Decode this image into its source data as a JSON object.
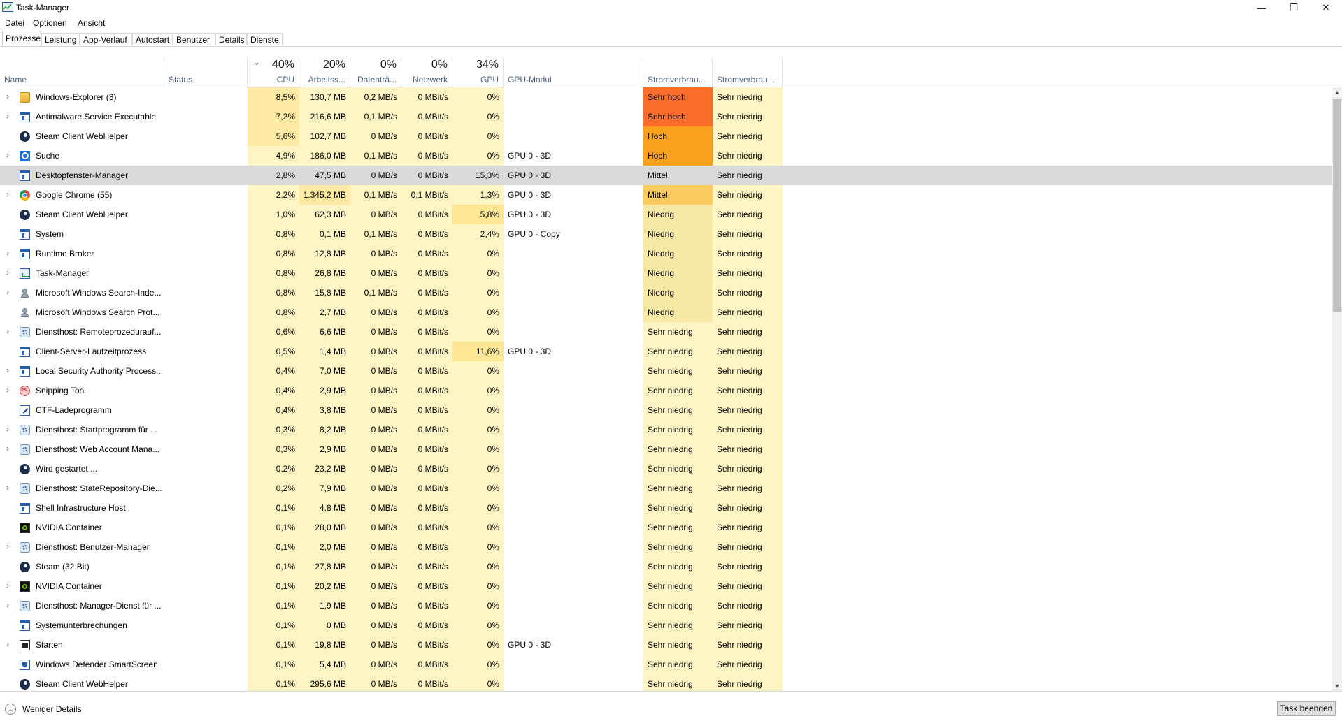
{
  "window": {
    "title": "Task-Manager",
    "minimize_glyph": "—",
    "maximize_glyph": "❐",
    "close_glyph": "✕"
  },
  "menu": [
    "Datei",
    "Optionen",
    "Ansicht"
  ],
  "tabs": [
    "Prozesse",
    "Leistung",
    "App-Verlauf",
    "Autostart",
    "Benutzer",
    "Details",
    "Dienste"
  ],
  "active_tab": "Prozesse",
  "columns": {
    "name": "Name",
    "status": "Status",
    "cpu": {
      "pct": "40%",
      "label": "CPU"
    },
    "mem": {
      "pct": "20%",
      "label": "Arbeitss..."
    },
    "disk": {
      "pct": "0%",
      "label": "Datenträ..."
    },
    "net": {
      "pct": "0%",
      "label": "Netzwerk"
    },
    "gpu": {
      "pct": "34%",
      "label": "GPU"
    },
    "gpumod": "GPU-Modul",
    "power": "Stromverbrau...",
    "power2": "Stromverbrau...",
    "sort_glyph": "⌄"
  },
  "heat_colors": {
    "light": "#fff4c4",
    "medium": "#ffeaa4",
    "gpu_high": "#fde694",
    "sehr_hoch": "#fb6d2a",
    "hoch": "#f8a11f",
    "mittel": "#fbcb61",
    "niedrig": "#f8e8a6",
    "sehr_niedrig": "#fff4c4"
  },
  "processes": [
    {
      "expandable": true,
      "icon": "folder",
      "name": "Windows-Explorer (3)",
      "cpu": "8,5%",
      "mem": "130,7 MB",
      "disk": "0,2 MB/s",
      "net": "0 MBit/s",
      "gpu": "0%",
      "gpumod": "",
      "power": "Sehr hoch",
      "power2": "Sehr niedrig"
    },
    {
      "expandable": true,
      "icon": "window",
      "name": "Antimalware Service Executable",
      "cpu": "7,2%",
      "mem": "216,6 MB",
      "disk": "0,1 MB/s",
      "net": "0 MBit/s",
      "gpu": "0%",
      "gpumod": "",
      "power": "Sehr hoch",
      "power2": "Sehr niedrig"
    },
    {
      "expandable": false,
      "icon": "steam",
      "name": "Steam Client WebHelper",
      "cpu": "5,6%",
      "mem": "102,7 MB",
      "disk": "0 MB/s",
      "net": "0 MBit/s",
      "gpu": "0%",
      "gpumod": "",
      "power": "Hoch",
      "power2": "Sehr niedrig"
    },
    {
      "expandable": true,
      "icon": "search",
      "name": "Suche",
      "cpu": "4,9%",
      "mem": "186,0 MB",
      "disk": "0,1 MB/s",
      "net": "0 MBit/s",
      "gpu": "0%",
      "gpumod": "GPU 0 - 3D",
      "power": "Hoch",
      "power2": "Sehr niedrig"
    },
    {
      "expandable": false,
      "icon": "window",
      "name": "Desktopfenster-Manager",
      "cpu": "2,8%",
      "mem": "47,5 MB",
      "disk": "0 MB/s",
      "net": "0 MBit/s",
      "gpu": "15,3%",
      "gpumod": "GPU 0 - 3D",
      "power": "Mittel",
      "power2": "Sehr niedrig",
      "selected": true
    },
    {
      "expandable": true,
      "icon": "chrome",
      "name": "Google Chrome (55)",
      "cpu": "2,2%",
      "mem": "1.345,2 MB",
      "disk": "0,1 MB/s",
      "net": "0,1 MBit/s",
      "gpu": "1,3%",
      "gpumod": "GPU 0 - 3D",
      "power": "Mittel",
      "power2": "Sehr niedrig"
    },
    {
      "expandable": false,
      "icon": "steam",
      "name": "Steam Client WebHelper",
      "cpu": "1,0%",
      "mem": "62,3 MB",
      "disk": "0 MB/s",
      "net": "0 MBit/s",
      "gpu": "5,8%",
      "gpumod": "GPU 0 - 3D",
      "power": "Niedrig",
      "power2": "Sehr niedrig"
    },
    {
      "expandable": false,
      "icon": "window",
      "name": "System",
      "cpu": "0,8%",
      "mem": "0,1 MB",
      "disk": "0,1 MB/s",
      "net": "0 MBit/s",
      "gpu": "2,4%",
      "gpumod": "GPU 0 - Copy",
      "power": "Niedrig",
      "power2": "Sehr niedrig"
    },
    {
      "expandable": true,
      "icon": "window",
      "name": "Runtime Broker",
      "cpu": "0,8%",
      "mem": "12,8 MB",
      "disk": "0 MB/s",
      "net": "0 MBit/s",
      "gpu": "0%",
      "gpumod": "",
      "power": "Niedrig",
      "power2": "Sehr niedrig"
    },
    {
      "expandable": true,
      "icon": "taskmgr",
      "name": "Task-Manager",
      "cpu": "0,8%",
      "mem": "26,8 MB",
      "disk": "0 MB/s",
      "net": "0 MBit/s",
      "gpu": "0%",
      "gpumod": "",
      "power": "Niedrig",
      "power2": "Sehr niedrig"
    },
    {
      "expandable": true,
      "icon": "person",
      "name": "Microsoft Windows Search-Inde...",
      "cpu": "0,8%",
      "mem": "15,8 MB",
      "disk": "0,1 MB/s",
      "net": "0 MBit/s",
      "gpu": "0%",
      "gpumod": "",
      "power": "Niedrig",
      "power2": "Sehr niedrig"
    },
    {
      "expandable": false,
      "icon": "person",
      "name": "Microsoft Windows Search Prot...",
      "cpu": "0,8%",
      "mem": "2,7 MB",
      "disk": "0 MB/s",
      "net": "0 MBit/s",
      "gpu": "0%",
      "gpumod": "",
      "power": "Niedrig",
      "power2": "Sehr niedrig"
    },
    {
      "expandable": true,
      "icon": "gear",
      "name": "Diensthost: Remoteprozedurauf...",
      "cpu": "0,6%",
      "mem": "6,6 MB",
      "disk": "0 MB/s",
      "net": "0 MBit/s",
      "gpu": "0%",
      "gpumod": "",
      "power": "Sehr niedrig",
      "power2": "Sehr niedrig"
    },
    {
      "expandable": false,
      "icon": "window",
      "name": "Client-Server-Laufzeitprozess",
      "cpu": "0,5%",
      "mem": "1,4 MB",
      "disk": "0 MB/s",
      "net": "0 MBit/s",
      "gpu": "11,6%",
      "gpumod": "GPU 0 - 3D",
      "power": "Sehr niedrig",
      "power2": "Sehr niedrig"
    },
    {
      "expandable": true,
      "icon": "window",
      "name": "Local Security Authority Process...",
      "cpu": "0,4%",
      "mem": "7,0 MB",
      "disk": "0 MB/s",
      "net": "0 MBit/s",
      "gpu": "0%",
      "gpumod": "",
      "power": "Sehr niedrig",
      "power2": "Sehr niedrig"
    },
    {
      "expandable": true,
      "icon": "snip",
      "name": "Snipping Tool",
      "cpu": "0,4%",
      "mem": "2,9 MB",
      "disk": "0 MB/s",
      "net": "0 MBit/s",
      "gpu": "0%",
      "gpumod": "",
      "power": "Sehr niedrig",
      "power2": "Sehr niedrig"
    },
    {
      "expandable": false,
      "icon": "pen",
      "name": "CTF-Ladeprogramm",
      "cpu": "0,4%",
      "mem": "3,8 MB",
      "disk": "0 MB/s",
      "net": "0 MBit/s",
      "gpu": "0%",
      "gpumod": "",
      "power": "Sehr niedrig",
      "power2": "Sehr niedrig"
    },
    {
      "expandable": true,
      "icon": "gear",
      "name": "Diensthost: Startprogramm für ...",
      "cpu": "0,3%",
      "mem": "8,2 MB",
      "disk": "0 MB/s",
      "net": "0 MBit/s",
      "gpu": "0%",
      "gpumod": "",
      "power": "Sehr niedrig",
      "power2": "Sehr niedrig"
    },
    {
      "expandable": true,
      "icon": "gear",
      "name": "Diensthost: Web Account Mana...",
      "cpu": "0,3%",
      "mem": "2,9 MB",
      "disk": "0 MB/s",
      "net": "0 MBit/s",
      "gpu": "0%",
      "gpumod": "",
      "power": "Sehr niedrig",
      "power2": "Sehr niedrig"
    },
    {
      "expandable": false,
      "icon": "steam",
      "name": "Wird gestartet ...",
      "cpu": "0,2%",
      "mem": "23,2 MB",
      "disk": "0 MB/s",
      "net": "0 MBit/s",
      "gpu": "0%",
      "gpumod": "",
      "power": "Sehr niedrig",
      "power2": "Sehr niedrig"
    },
    {
      "expandable": true,
      "icon": "gear",
      "name": "Diensthost: StateRepository-Die...",
      "cpu": "0,2%",
      "mem": "7,9 MB",
      "disk": "0 MB/s",
      "net": "0 MBit/s",
      "gpu": "0%",
      "gpumod": "",
      "power": "Sehr niedrig",
      "power2": "Sehr niedrig"
    },
    {
      "expandable": false,
      "icon": "window",
      "name": "Shell Infrastructure Host",
      "cpu": "0,1%",
      "mem": "4,8 MB",
      "disk": "0 MB/s",
      "net": "0 MBit/s",
      "gpu": "0%",
      "gpumod": "",
      "power": "Sehr niedrig",
      "power2": "Sehr niedrig"
    },
    {
      "expandable": false,
      "icon": "nvidia",
      "name": "NVIDIA Container",
      "cpu": "0,1%",
      "mem": "28,0 MB",
      "disk": "0 MB/s",
      "net": "0 MBit/s",
      "gpu": "0%",
      "gpumod": "",
      "power": "Sehr niedrig",
      "power2": "Sehr niedrig"
    },
    {
      "expandable": true,
      "icon": "gear",
      "name": "Diensthost: Benutzer-Manager",
      "cpu": "0,1%",
      "mem": "2,0 MB",
      "disk": "0 MB/s",
      "net": "0 MBit/s",
      "gpu": "0%",
      "gpumod": "",
      "power": "Sehr niedrig",
      "power2": "Sehr niedrig"
    },
    {
      "expandable": false,
      "icon": "steam",
      "name": "Steam (32 Bit)",
      "cpu": "0,1%",
      "mem": "27,8 MB",
      "disk": "0 MB/s",
      "net": "0 MBit/s",
      "gpu": "0%",
      "gpumod": "",
      "power": "Sehr niedrig",
      "power2": "Sehr niedrig"
    },
    {
      "expandable": true,
      "icon": "nvidia",
      "name": "NVIDIA Container",
      "cpu": "0,1%",
      "mem": "20,2 MB",
      "disk": "0 MB/s",
      "net": "0 MBit/s",
      "gpu": "0%",
      "gpumod": "",
      "power": "Sehr niedrig",
      "power2": "Sehr niedrig"
    },
    {
      "expandable": true,
      "icon": "gear",
      "name": "Diensthost: Manager-Dienst für ...",
      "cpu": "0,1%",
      "mem": "1,9 MB",
      "disk": "0 MB/s",
      "net": "0 MBit/s",
      "gpu": "0%",
      "gpumod": "",
      "power": "Sehr niedrig",
      "power2": "Sehr niedrig"
    },
    {
      "expandable": false,
      "icon": "window",
      "name": "Systemunterbrechungen",
      "cpu": "0,1%",
      "mem": "0 MB",
      "disk": "0 MB/s",
      "net": "0 MBit/s",
      "gpu": "0%",
      "gpumod": "",
      "power": "Sehr niedrig",
      "power2": "Sehr niedrig"
    },
    {
      "expandable": true,
      "icon": "start",
      "name": "Starten",
      "cpu": "0,1%",
      "mem": "19,8 MB",
      "disk": "0 MB/s",
      "net": "0 MBit/s",
      "gpu": "0%",
      "gpumod": "GPU 0 - 3D",
      "power": "Sehr niedrig",
      "power2": "Sehr niedrig"
    },
    {
      "expandable": false,
      "icon": "shield",
      "name": "Windows Defender SmartScreen",
      "cpu": "0,1%",
      "mem": "5,4 MB",
      "disk": "0 MB/s",
      "net": "0 MBit/s",
      "gpu": "0%",
      "gpumod": "",
      "power": "Sehr niedrig",
      "power2": "Sehr niedrig"
    },
    {
      "expandable": false,
      "icon": "steam",
      "name": "Steam Client WebHelper",
      "cpu": "0,1%",
      "mem": "295,6 MB",
      "disk": "0 MB/s",
      "net": "0 MBit/s",
      "gpu": "0%",
      "gpumod": "",
      "power": "Sehr niedrig",
      "power2": "Sehr niedrig"
    }
  ],
  "footer": {
    "fewer_details": "Weniger Details",
    "fewer_glyph": "︿",
    "end_task": "Task beenden"
  },
  "scrollbar": {
    "up_glyph": "▲",
    "down_glyph": "▼"
  }
}
